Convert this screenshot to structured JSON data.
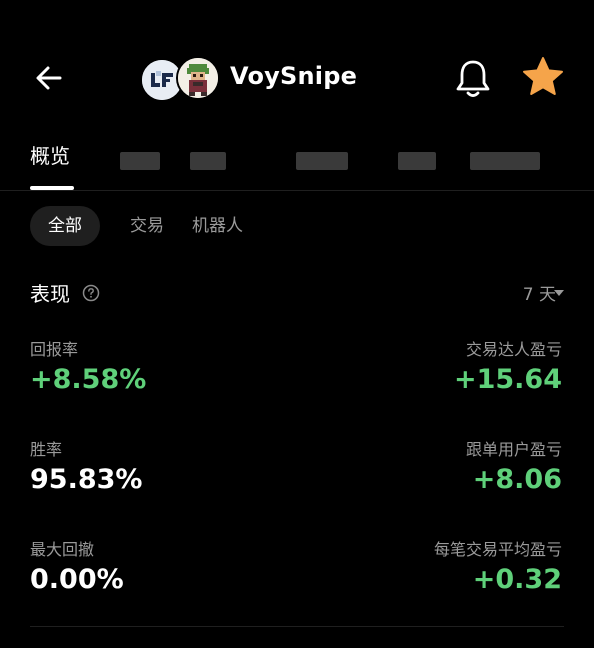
{
  "header": {
    "title": "VoySnipe",
    "back_icon": "arrow-left-icon",
    "bell_icon": "bell-icon",
    "star_icon": "star-icon",
    "star_color": "#f5a44a"
  },
  "tabs": {
    "active_label": "概览"
  },
  "filters": {
    "all": "全部",
    "trade": "交易",
    "bot": "机器人"
  },
  "performance": {
    "title": "表现",
    "period": "7 天"
  },
  "stats": {
    "return_rate_label": "回报率",
    "return_rate_value": "+8.58%",
    "trader_pnl_label": "交易达人盈亏",
    "trader_pnl_value": "+15.64",
    "win_rate_label": "胜率",
    "win_rate_value": "95.83%",
    "copier_pnl_label": "跟单用户盈亏",
    "copier_pnl_value": "+8.06",
    "max_drawdown_label": "最大回撤",
    "max_drawdown_value": "0.00%",
    "avg_trade_pnl_label": "每笔交易平均盈亏",
    "avg_trade_pnl_value": "+0.32"
  },
  "colors": {
    "positive": "#5fd07a",
    "background": "#000000"
  }
}
